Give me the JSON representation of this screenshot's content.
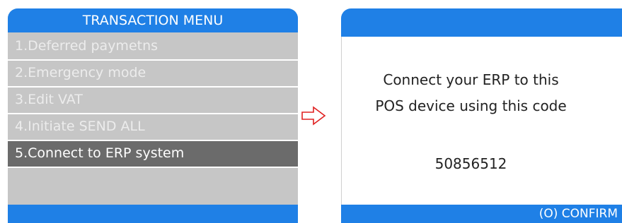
{
  "menu": {
    "title": "TRANSACTION MENU",
    "items": [
      {
        "label": "1.Deferred paymetns"
      },
      {
        "label": "2.Emergency mode"
      },
      {
        "label": "3.Edit VAT"
      },
      {
        "label": "4.Initiate SEND ALL"
      },
      {
        "label": "5.Connect to ERP system"
      }
    ],
    "selected_index": 4
  },
  "arrow": {
    "icon": "arrow-right-icon",
    "color": "#e02020"
  },
  "confirm": {
    "message_line1": "Connect your ERP to this",
    "message_line2": "POS device using this code",
    "code": "50856512",
    "confirm_label": "(O) CONFIRM"
  },
  "colors": {
    "header_blue": "#1f80e6",
    "menu_gray": "#c6c6c6",
    "selected_gray": "#6b6b6b"
  }
}
